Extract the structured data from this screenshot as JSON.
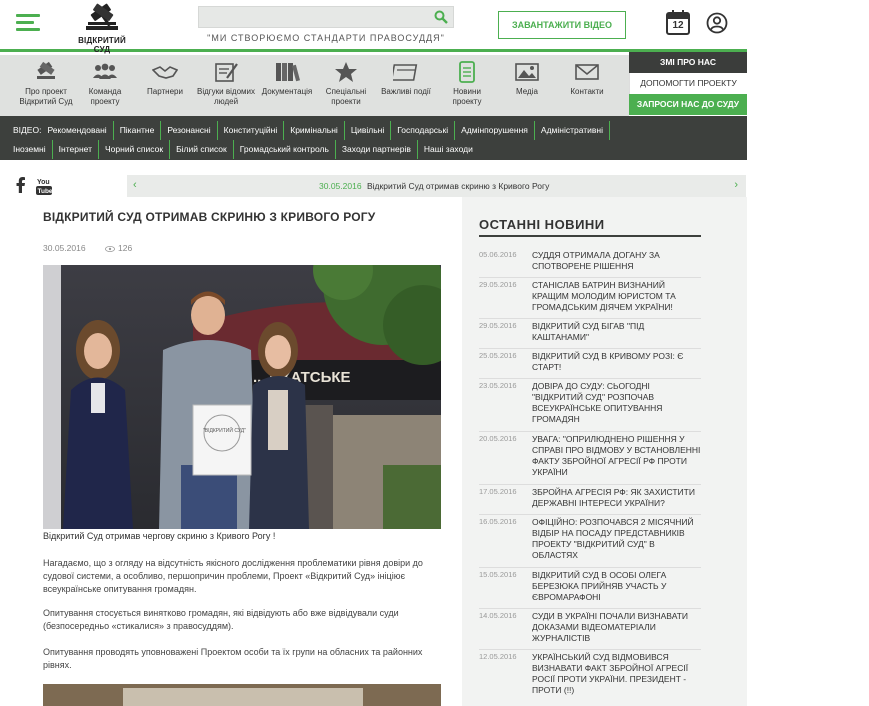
{
  "header": {
    "logo_text": "ВІДКРИТИЙ СУД",
    "search_placeholder": "",
    "slogan": "\"МИ СТВОРЮЄМО СТАНДАРТИ ПРАВОСУДДЯ\"",
    "video_button": "ЗАВАНТАЖИТИ ВІДЕО",
    "calendar_day": "12"
  },
  "categories": [
    {
      "label": "Про проект Відкритий Суд",
      "icon": "gavel-icon"
    },
    {
      "label": "Команда проекту",
      "icon": "team-icon"
    },
    {
      "label": "Партнери",
      "icon": "handshake-icon"
    },
    {
      "label": "Відгуки відомих людей",
      "icon": "feedback-icon"
    },
    {
      "label": "Документація",
      "icon": "books-icon"
    },
    {
      "label": "Спеціальні проекти",
      "icon": "star-icon"
    },
    {
      "label": "Важливі події",
      "icon": "calendar-events-icon"
    },
    {
      "label": "Новини проекту",
      "icon": "document-icon"
    },
    {
      "label": "Медіа",
      "icon": "image-icon"
    },
    {
      "label": "Контакти",
      "icon": "envelope-icon"
    }
  ],
  "sidebox": {
    "smi": "ЗМІ ПРО НАС",
    "help": "ДОПОМОГТИ ПРОЕКТУ",
    "invite": "ЗАПРОСИ НАС ДО СУДУ"
  },
  "video_nav": {
    "label": "ВІДЕО:",
    "row1": [
      "Рекомендовані",
      "Пікантне",
      "Резонансні",
      "Конституційні",
      "Кримінальні",
      "Цивільні",
      "Господарські",
      "Адмінпорушення",
      "Адміністративні"
    ],
    "row2": [
      "Іноземні",
      "Інтернет",
      "Чорний список",
      "Білий список",
      "Громадський контроль",
      "Заходи партнерів",
      "Наші заходи"
    ]
  },
  "ticker": {
    "date": "30.05.2016",
    "text": "Відкритий Суд отримав скриню з Кривого Рогу"
  },
  "article": {
    "title": "ВІДКРИТИЙ СУД ОТРИМАВ СКРИНЮ З КРИВОГО РОГУ",
    "date": "30.05.2016",
    "views": "126",
    "caption": "Відкритий Суд отримав чергову скриню з Кривого Рогу !",
    "paragraphs": [
      "Нагадаємо, що з огляду на відсутність якісного дослідження проблематики рівня довіри до судової системи, а особливо, першопричин проблеми, Проект «Відкритий Суд» ініціює всеукраїнське опитування громадян.",
      "Опитування стосується винятково громадян, які відвідують або вже відвідували суди (безпосередньо «стикалися» з правосуддям).",
      "Опитування проводять уповноважені Проектом особи та їх групи на обласних та районних рівнях."
    ],
    "photo_sign": "НЕ ... ОКАТСЬКЕ",
    "box_label": "\"ВІДКРИТИЙ СУД\""
  },
  "news": {
    "title": "ОСТАННІ НОВИНИ",
    "items": [
      {
        "date": "05.06.2016",
        "title": "Суддя отримала догану за спотворене рішення"
      },
      {
        "date": "29.05.2016",
        "title": "Станіслав Батрин визнаний кращим молодим юристом та громадським діячем України!"
      },
      {
        "date": "29.05.2016",
        "title": "Відкритий Суд бігав \"Під каштанами\""
      },
      {
        "date": "25.05.2016",
        "title": "Відкритий суд в Кривому Розі: Є старт!"
      },
      {
        "date": "23.05.2016",
        "title": "Довіра до суду: Сьогодні \"Відкритий суд\" розпочав всеукраїнське опитування громадян"
      },
      {
        "date": "20.05.2016",
        "title": "УВАГА: \"Оприлюднено рішення у справі про відмову у встановленні факту збройної агресії РФ проти України"
      },
      {
        "date": "17.05.2016",
        "title": "Збройна агресія РФ: як захистити державні інтереси України?"
      },
      {
        "date": "16.05.2016",
        "title": "Офіційно: Розпочався 2 місячний відбір на посаду представників проекту \"Відкритий суд\" в областях"
      },
      {
        "date": "15.05.2016",
        "title": "Відкритий суд в особі Олега Березюка прийняв участь у Євромарафоні"
      },
      {
        "date": "14.05.2016",
        "title": "Суди в Україні почали визнавати доказами відеоматеріали журналістів"
      },
      {
        "date": "12.05.2016",
        "title": "Український суд відмовився визнавати факт збройної агресії Росії проти України. Президент - проти (!!)"
      }
    ]
  },
  "colors": {
    "accent": "#4caf50",
    "dark": "#3d403d",
    "panel": "#f2f3f2"
  }
}
